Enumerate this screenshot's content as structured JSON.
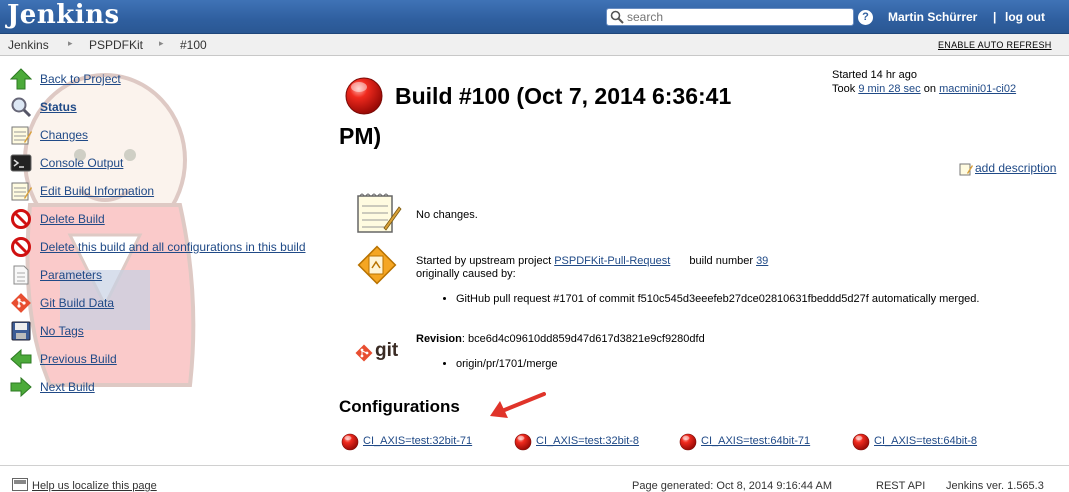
{
  "header": {
    "logo": "Jenkins",
    "search_placeholder": "search",
    "help": "?",
    "user": "Martin Schürrer",
    "separator": "|",
    "logout": "log out"
  },
  "breadcrumb": {
    "items": [
      "Jenkins",
      "PSPDFKit",
      "#100"
    ],
    "auto_refresh": "ENABLE AUTO REFRESH"
  },
  "sidebar": {
    "items": [
      {
        "label": "Back to Project",
        "icon": "up-arrow-icon"
      },
      {
        "label": "Status",
        "icon": "magnifier-icon",
        "current": true
      },
      {
        "label": "Changes",
        "icon": "notepad-icon"
      },
      {
        "label": "Console Output",
        "icon": "terminal-icon"
      },
      {
        "label": "Edit Build Information",
        "icon": "notepad-icon"
      },
      {
        "label": "Delete Build",
        "icon": "no-entry-icon"
      },
      {
        "label": "Delete this build and all configurations in this build",
        "icon": "no-entry-icon"
      },
      {
        "label": "Parameters",
        "icon": "document-icon"
      },
      {
        "label": "Git Build Data",
        "icon": "git-icon"
      },
      {
        "label": "No Tags",
        "icon": "floppy-icon"
      },
      {
        "label": "Previous Build",
        "icon": "left-arrow-icon"
      },
      {
        "label": "Next Build",
        "icon": "right-arrow-icon"
      }
    ]
  },
  "build": {
    "title_line1": "Build #100 (Oct 7, 2014 6:36:41",
    "title_line2": "PM)",
    "started_label": "Started 14 hr ago",
    "took_prefix": "Took",
    "took_duration": "9 min 28 sec",
    "took_on": "on",
    "node": "macmini01-ci02",
    "add_description": "add description"
  },
  "changes": {
    "text": "No changes."
  },
  "cause": {
    "prefix": "Started by upstream project",
    "project": "PSPDFKit-Pull-Request",
    "build_number_label": "build number",
    "build_number": "39",
    "originally": "originally caused by:",
    "bullet": "GitHub pull request #1701 of commit f510c545d3eeefeb27dce02810631fbeddd5d27f automatically merged."
  },
  "git": {
    "logo": "git",
    "revision_label": "Revision",
    "revision": ": bce6d4c09610dd859d47d617d3821e9cf9280dfd",
    "branch": "origin/pr/1701/merge"
  },
  "configurations": {
    "heading": "Configurations",
    "items": [
      "CI_AXIS=test:32bit-71",
      "CI_AXIS=test:32bit-8",
      "CI_AXIS=test:64bit-71",
      "CI_AXIS=test:64bit-8"
    ]
  },
  "footer": {
    "localize": "Help us localize this page",
    "generated": "Page generated: Oct 8, 2014 9:16:44 AM",
    "rest_api": "REST API",
    "version": "Jenkins ver. 1.565.3"
  },
  "colors": {
    "header_blue": "#2f5f9f",
    "link": "#204a87",
    "failed_red": "#e01010",
    "arrow_red": "#e0342a"
  }
}
